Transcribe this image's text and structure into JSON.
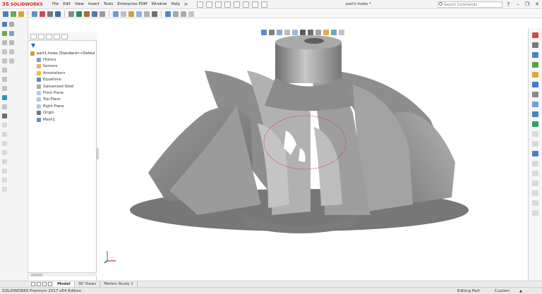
{
  "app": {
    "logo_text": "SOLIDWORKS",
    "window_title": "part1-holes *"
  },
  "menu": {
    "items": [
      "File",
      "Edit",
      "View",
      "Insert",
      "Tools",
      "Enterprise PDM",
      "Window",
      "Help"
    ]
  },
  "search": {
    "placeholder": "Search Commands"
  },
  "feature_tree": {
    "root_label": "part1-holes  (Standard<<Defaul",
    "items": [
      {
        "label": "History",
        "icon": "history-icon"
      },
      {
        "label": "Sensors",
        "icon": "sensors-icon"
      },
      {
        "label": "Annotations",
        "icon": "annotations-icon"
      },
      {
        "label": "Equations",
        "icon": "equations-icon"
      },
      {
        "label": "Galvanized Steel",
        "icon": "material-icon"
      },
      {
        "label": "Front Plane",
        "icon": "plane-icon"
      },
      {
        "label": "Top Plane",
        "icon": "plane-icon"
      },
      {
        "label": "Right Plane",
        "icon": "plane-icon"
      },
      {
        "label": "Origin",
        "icon": "origin-icon"
      },
      {
        "label": "Mesh1",
        "icon": "mesh-icon"
      }
    ]
  },
  "bottom_tabs": [
    "Model",
    "3D Views",
    "Motion Study 1"
  ],
  "status": {
    "product": "SOLIDWORKS Premium 2017 x64 Edition",
    "mode": "Editing Part",
    "units": "Custom"
  },
  "colors": {
    "brand": "#d8222a",
    "model_fill": "#8f8f8f",
    "selection_ellipse": "#d6336c",
    "background": "#ffffff"
  }
}
